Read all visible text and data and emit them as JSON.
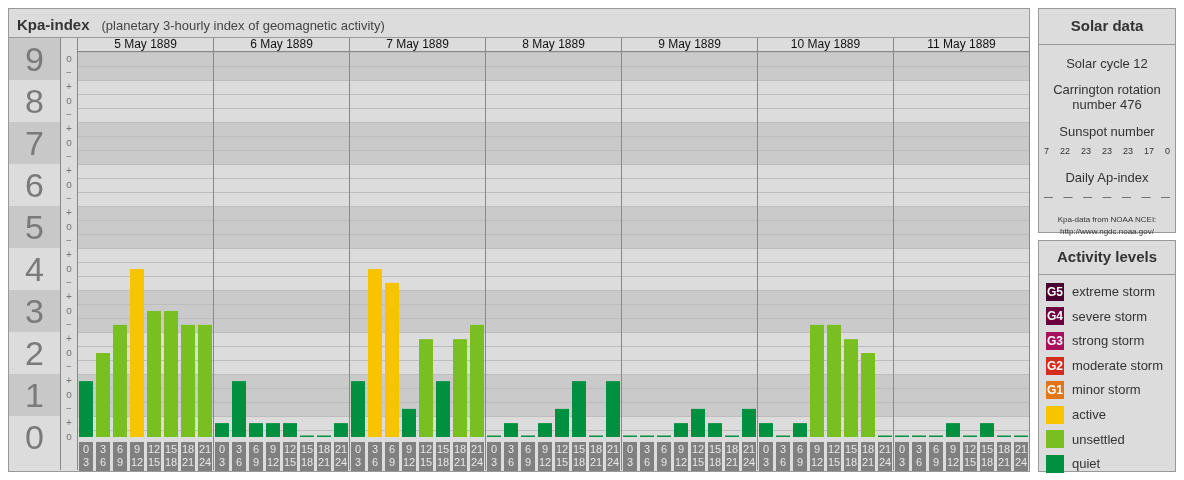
{
  "kp_panel": {
    "title": "Kpa-index",
    "subtitle": "(planetary 3-hourly index of geomagnetic activity)",
    "days": [
      {
        "label": "5 May 1889"
      },
      {
        "label": "6 May 1889"
      },
      {
        "label": "7 May 1889"
      },
      {
        "label": "8 May 1889"
      },
      {
        "label": "9 May 1889"
      },
      {
        "label": "10 May 1889"
      },
      {
        "label": "11 May 1889"
      }
    ],
    "sub_ticks": [
      "o",
      "−",
      "+",
      "o",
      "−",
      "+",
      "o",
      "−",
      "+",
      "o",
      "−",
      "+",
      "o",
      "−",
      "+",
      "o",
      "−",
      "+",
      "o",
      "−",
      "+",
      "o",
      "−",
      "+",
      "o",
      "−",
      "+",
      "o"
    ],
    "chart_data": {
      "type": "bar",
      "ylim": [
        0,
        9
      ],
      "yticks": [
        0,
        1,
        2,
        3,
        4,
        5,
        6,
        7,
        8,
        9
      ],
      "grid": true,
      "categories": [
        "0 3",
        "3 6",
        "6 9",
        "9 12",
        "12 15",
        "15 18",
        "18 21",
        "21 24",
        "0 3",
        "3 6",
        "6 9",
        "9 12",
        "12 15",
        "15 18",
        "18 21",
        "21 24",
        "0 3",
        "3 6",
        "6 9",
        "9 12",
        "12 15",
        "15 18",
        "18 21",
        "21 24",
        "0 3",
        "3 6",
        "6 9",
        "9 12",
        "12 15",
        "15 18",
        "18 21",
        "21 24",
        "0 3",
        "3 6",
        "6 9",
        "9 12",
        "12 15",
        "15 18",
        "18 21",
        "21 24",
        "0 3",
        "3 6",
        "6 9",
        "9 12",
        "12 15",
        "15 18",
        "18 21",
        "21 24",
        "0 3",
        "3 6",
        "6 9",
        "9 12",
        "12 15",
        "15 18",
        "18 21",
        "21 24"
      ],
      "values": [
        1.33,
        2,
        2.67,
        4,
        3,
        3,
        2.67,
        2.67,
        0.33,
        1.33,
        0.33,
        0.33,
        0.33,
        0,
        0,
        0.33,
        1.33,
        4,
        3.67,
        0.67,
        2.33,
        1.33,
        2.33,
        2.67,
        0,
        0.33,
        0,
        0.33,
        0.67,
        1.33,
        0,
        1.33,
        0,
        0,
        0,
        0.33,
        0.67,
        0.33,
        0,
        0.67,
        0.33,
        0,
        0.33,
        2.67,
        2.67,
        2.33,
        2,
        0,
        0,
        0,
        0,
        0.33,
        0,
        0.33,
        0,
        0
      ]
    }
  },
  "solar_data": {
    "title": "Solar data",
    "solar_cycle": "Solar cycle 12",
    "carrington": "Carrington rotation number 476",
    "sunspot_label": "Sunspot number",
    "sunspot_numbers": [
      "7",
      "22",
      "23",
      "23",
      "23",
      "17",
      "0"
    ],
    "ap_label": "Daily Ap-index",
    "ap_values": [
      "—",
      "—",
      "—",
      "—",
      "—",
      "—",
      "—"
    ],
    "source": "Kpa-data from NOAA NCEI:",
    "source_url": "http://www.ngdc.noaa.gov/"
  },
  "activity_levels": {
    "title": "Activity levels",
    "items": [
      {
        "kind": "storm",
        "code": "G5",
        "label": "extreme storm",
        "color": "#4a0030"
      },
      {
        "kind": "storm",
        "code": "G4",
        "label": "severe storm",
        "color": "#6c0040"
      },
      {
        "kind": "storm",
        "code": "G3",
        "label": "strong storm",
        "color": "#a8105c"
      },
      {
        "kind": "storm",
        "code": "G2",
        "label": "moderate storm",
        "color": "#d42c1c"
      },
      {
        "kind": "storm",
        "code": "G1",
        "label": "minor storm",
        "color": "#e4761a"
      },
      {
        "kind": "active",
        "label": "active",
        "color": "#f8c400"
      },
      {
        "kind": "unsettled",
        "label": "unsettled",
        "color": "#78c020"
      },
      {
        "kind": "quiet",
        "label": "quiet",
        "color": "#009040"
      }
    ]
  }
}
